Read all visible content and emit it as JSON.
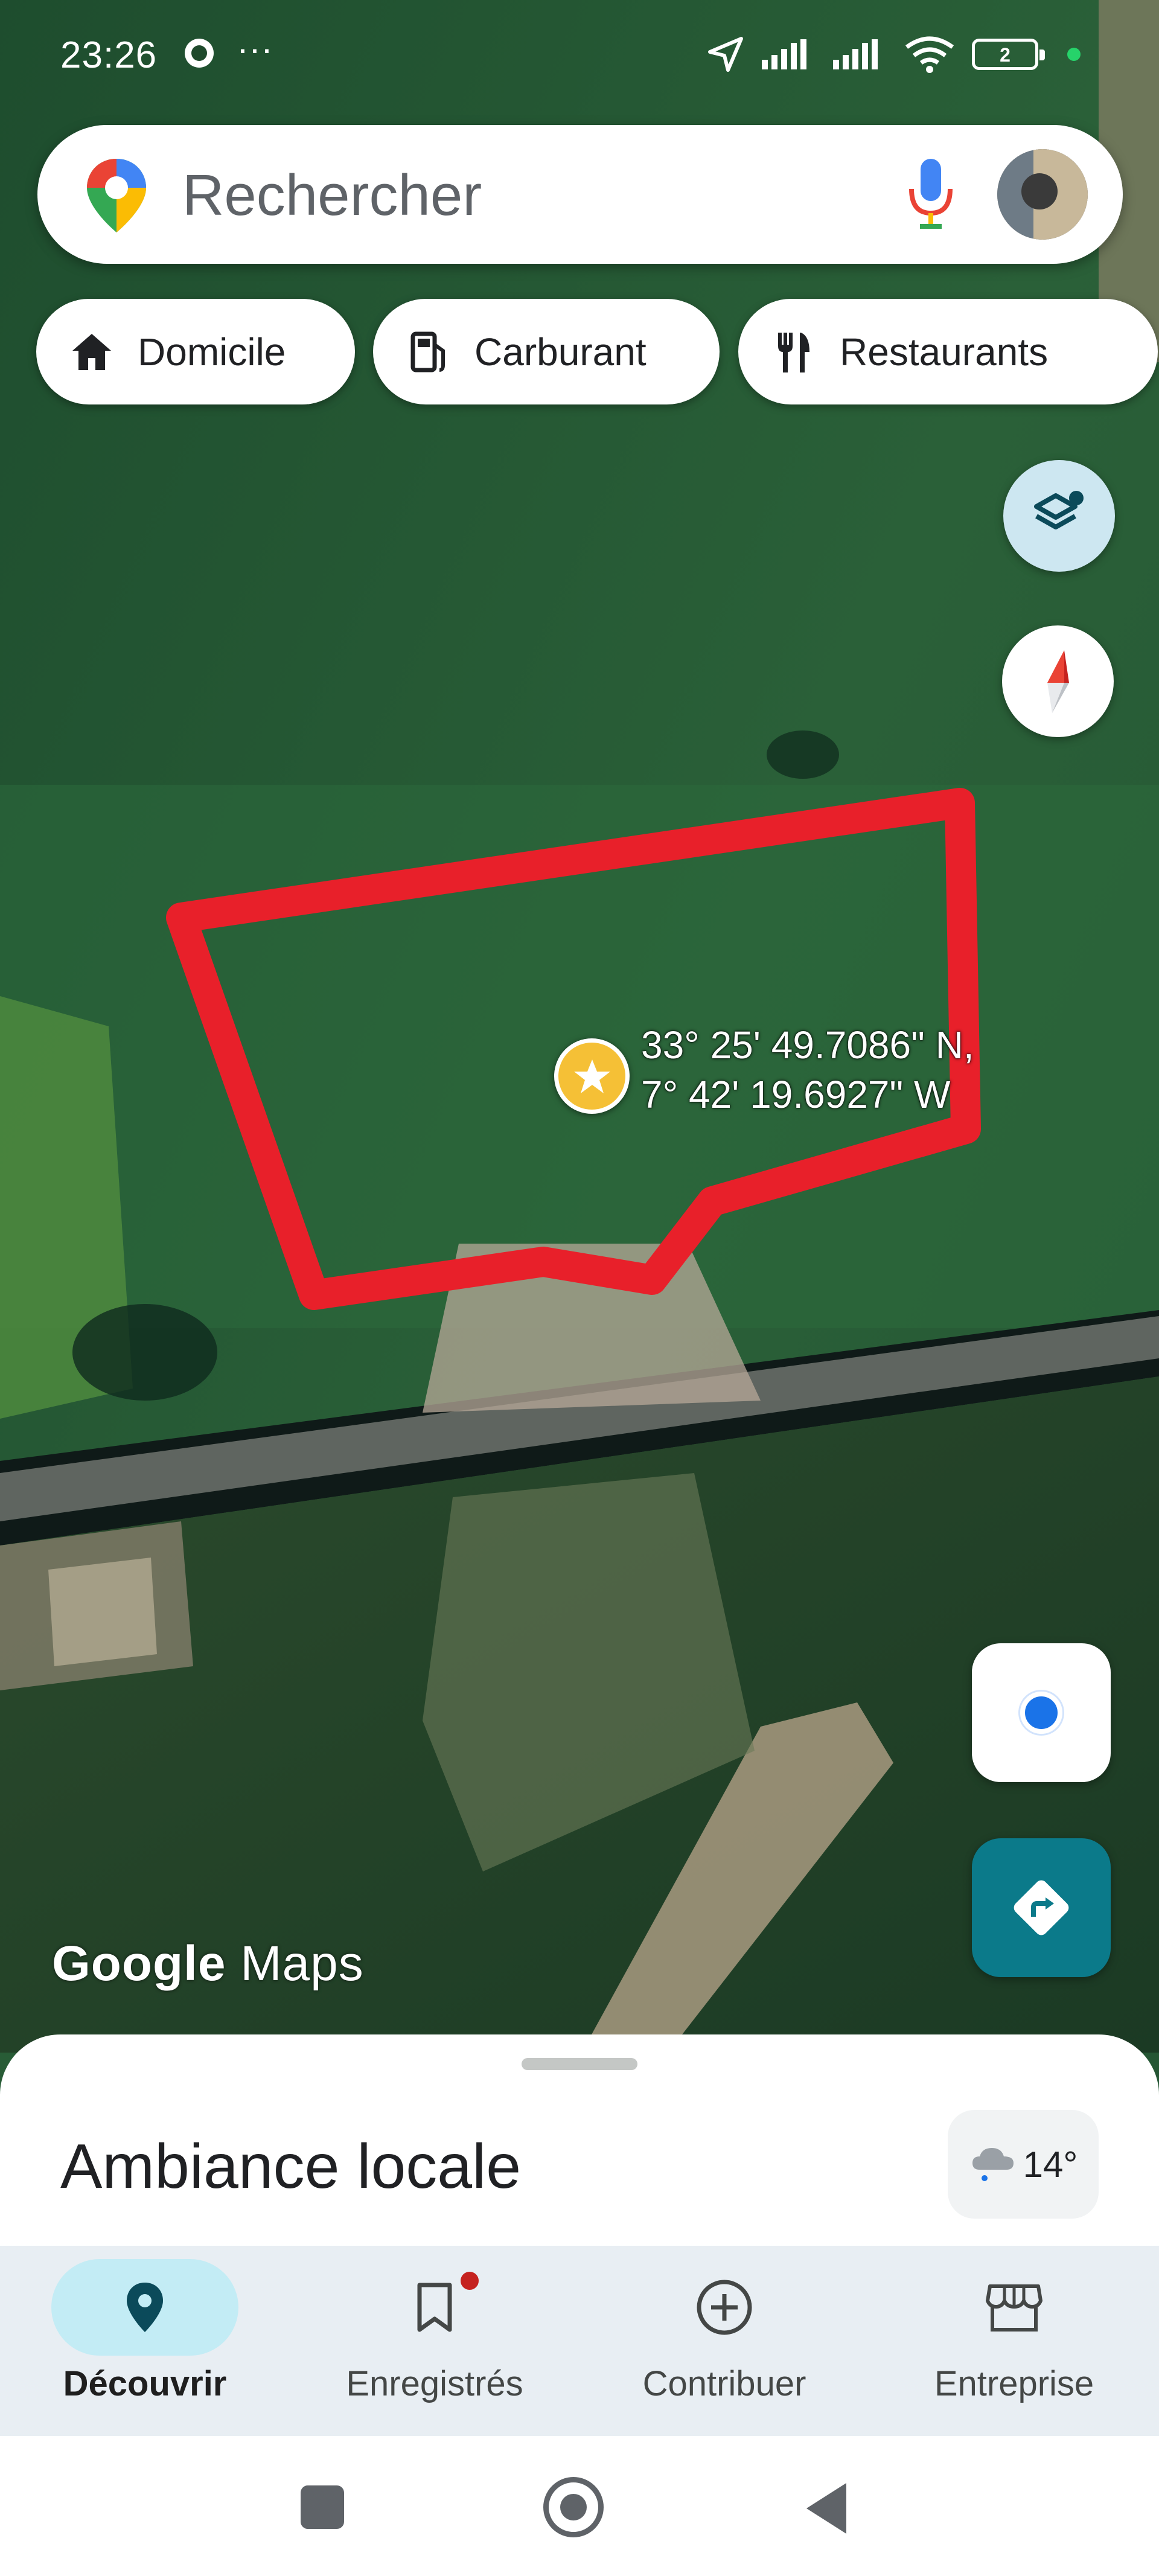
{
  "status_bar": {
    "time": "23:26",
    "dots": "···",
    "battery": "2"
  },
  "search": {
    "placeholder": "Rechercher"
  },
  "chips": [
    {
      "label": "Domicile",
      "icon": "home-icon"
    },
    {
      "label": "Carburant",
      "icon": "gas-station-icon"
    },
    {
      "label": "Restaurants",
      "icon": "restaurant-icon"
    }
  ],
  "map": {
    "coordinates": {
      "line1": "33° 25' 49.7086\" N,",
      "line2": "7° 42' 19.6927\" W"
    },
    "attribution_bold": "Google",
    "attribution": "Maps",
    "highlight_color": "#e8202a"
  },
  "sheet": {
    "title": "Ambiance locale",
    "temperature": "14°"
  },
  "bottom_nav": [
    {
      "label": "Découvrir",
      "icon": "explore-pin-icon",
      "active": true
    },
    {
      "label": "Enregistrés",
      "icon": "bookmark-icon",
      "badge": true
    },
    {
      "label": "Contribuer",
      "icon": "add-circle-icon"
    },
    {
      "label": "Entreprise",
      "icon": "storefront-icon"
    }
  ],
  "colors": {
    "accent": "#1a73e8",
    "directions": "#0b7a8a",
    "nav_active": "#c3ecf5"
  }
}
